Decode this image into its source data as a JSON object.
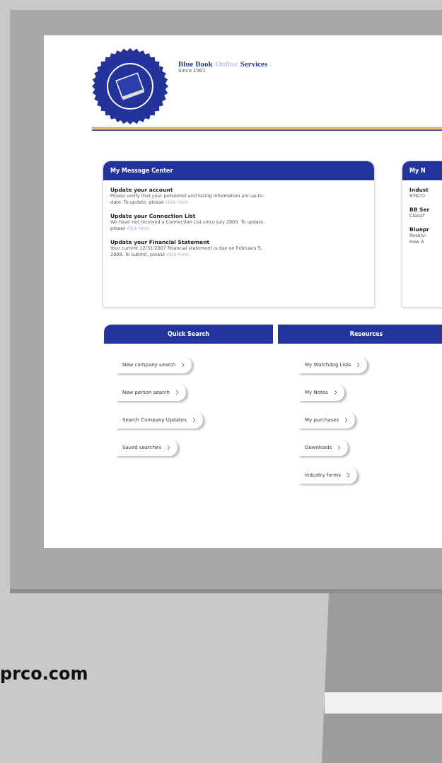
{
  "header": {
    "brand_prefix": "Blue Book",
    "brand_accent": "Online",
    "brand_suffix": "Services",
    "tagline": "Since 1901"
  },
  "message_center": {
    "title": "My Message Center",
    "messages": [
      {
        "title": "Update your account",
        "body": "Please verify that your personnel and listing information are up-to-date. To update, please",
        "link": "click here."
      },
      {
        "title": "Update your Connection List",
        "body": "We have not received a Connection List since July 2003. To update, please",
        "link": "click here."
      },
      {
        "title": "Update your Financial Statement",
        "body": "Your current 12/31/2007 financial statement is due on February 5, 2008. To submit, please",
        "link": "click here."
      }
    ]
  },
  "news": {
    "title": "My N",
    "items": [
      {
        "title": "Indust",
        "lines": [
          "SYSCO"
        ]
      },
      {
        "title": "BB Ser",
        "lines": [
          "Classif"
        ]
      },
      {
        "title": "Bluepr",
        "lines": [
          "Resolvi",
          "How A"
        ]
      }
    ]
  },
  "columns": [
    {
      "title": "Quick Search",
      "links": [
        "New company search",
        "New person search",
        "Search Company Updates",
        "Saved searches"
      ]
    },
    {
      "title": "Resources",
      "links": [
        "My Watchdog Lists",
        "My Notes",
        "My purchases",
        "Downloads",
        "Industry forms"
      ]
    }
  ],
  "caption": "prco.com"
}
